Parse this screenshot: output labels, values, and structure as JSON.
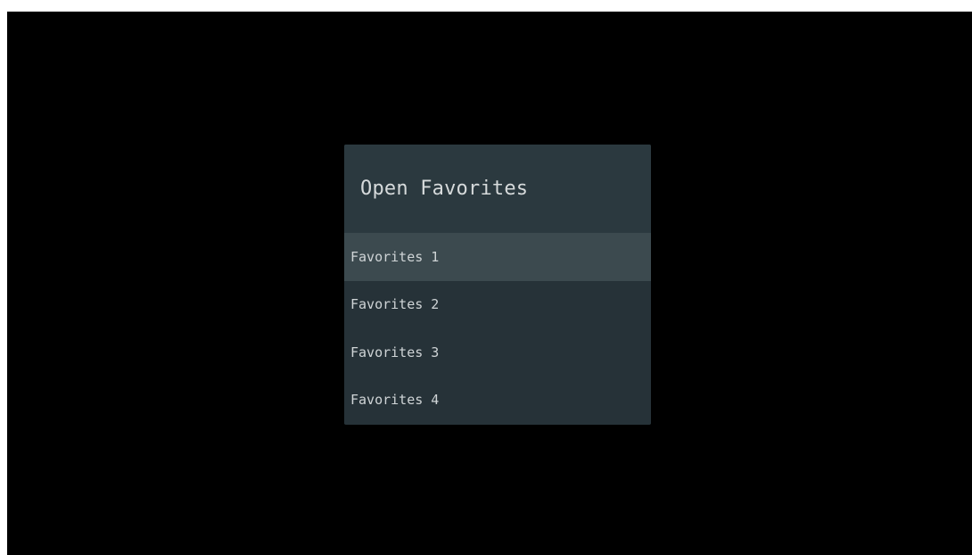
{
  "dialog": {
    "title": "Open Favorites",
    "items": [
      {
        "label": "Favorites 1",
        "selected": true
      },
      {
        "label": "Favorites 2",
        "selected": false
      },
      {
        "label": "Favorites 3",
        "selected": false
      },
      {
        "label": "Favorites 4",
        "selected": false
      }
    ]
  },
  "colors": {
    "background": "#000000",
    "dialog": "#263238",
    "header": "#2b393f",
    "selected_item": "#3c4a4f",
    "text": "#cfd4d6"
  }
}
